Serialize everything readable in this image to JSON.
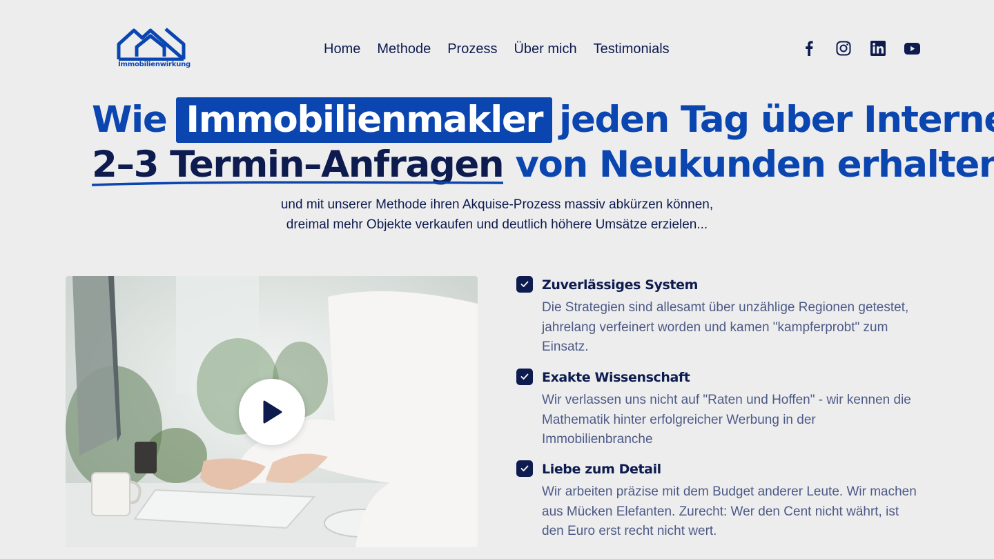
{
  "brand": {
    "logo_text": "Immobilienwirkung",
    "primary_color": "#0a45b0",
    "dark_color": "#0d1b4f",
    "background": "#ededee"
  },
  "nav": {
    "items": [
      {
        "label": "Home"
      },
      {
        "label": "Methode"
      },
      {
        "label": "Prozess"
      },
      {
        "label": "Über mich"
      },
      {
        "label": "Testimonials"
      }
    ]
  },
  "social": [
    "facebook-icon",
    "instagram-icon",
    "linkedin-icon",
    "youtube-icon"
  ],
  "hero": {
    "line1_prefix": "Wie",
    "line1_highlight": "Immobilienmakler",
    "line1_suffix": "jeden Tag über Internet",
    "line2_emphasis": "2–3 Termin–Anfragen",
    "line2_suffix": "von Neukunden erhalten...",
    "sub_line1": "und mit unserer Methode ihren Akquise-Prozess massiv abkürzen können,",
    "sub_line2": "dreimal mehr Objekte verkaufen und deutlich höhere Umsätze erzielen..."
  },
  "video": {
    "play_icon": "play-icon"
  },
  "features": [
    {
      "title": "Zuverlässiges System",
      "text": "Die Strategien sind allesamt über unzählige Regionen getestet, jahrelang verfeinert worden und kamen \"kampferprobt\" zum Einsatz."
    },
    {
      "title": "Exakte Wissenschaft",
      "text": "Wir verlassen uns nicht auf \"Raten und Hoffen\" - wir kennen die Mathematik hinter erfolgreicher Werbung in der Immobilienbranche"
    },
    {
      "title": "Liebe zum Detail",
      "text": "Wir arbeiten präzise mit dem Budget anderer Leute. Wir machen aus Mücken Elefanten. Zurecht: Wer den Cent nicht währt, ist den Euro erst recht nicht wert."
    }
  ]
}
